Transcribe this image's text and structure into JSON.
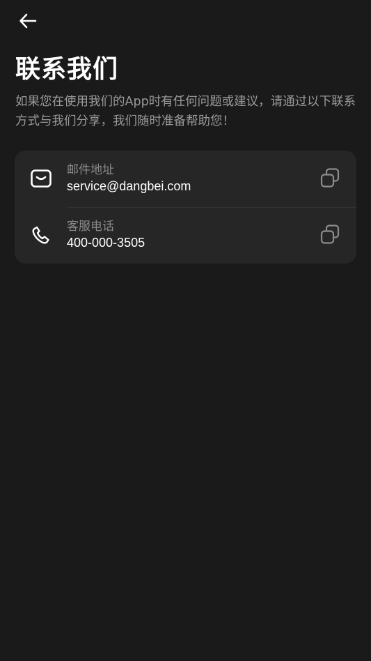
{
  "header": {
    "back_icon": "arrow-left-icon"
  },
  "page": {
    "title": "联系我们",
    "description": "如果您在使用我们的App时有任何问题或建议，请通过以下联系方式与我们分享，我们随时准备帮助您！"
  },
  "contacts": [
    {
      "icon": "mail-icon",
      "label": "邮件地址",
      "value": "service@dangbei.com",
      "action_icon": "copy-icon"
    },
    {
      "icon": "phone-icon",
      "label": "客服电话",
      "value": "400-000-3505",
      "action_icon": "copy-icon"
    }
  ],
  "colors": {
    "background": "#1a1a1a",
    "card": "#262626",
    "primary_text": "#ffffff",
    "secondary_text": "#9a9a9a",
    "label_text": "#8a8a8a",
    "copy_icon": "#8c8c8c"
  }
}
